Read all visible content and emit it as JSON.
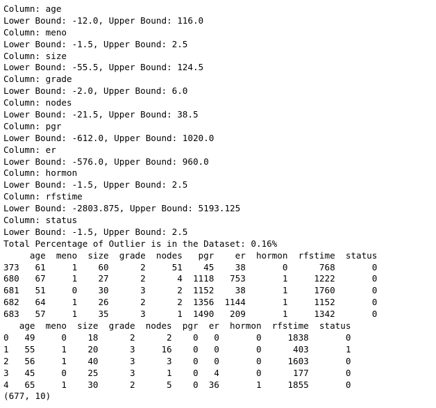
{
  "output": {
    "bounds": [
      {
        "column": "Column: age",
        "bounds": "Lower Bound: -12.0, Upper Bound: 116.0"
      },
      {
        "column": "Column: meno",
        "bounds": "Lower Bound: -1.5, Upper Bound: 2.5"
      },
      {
        "column": "Column: size",
        "bounds": "Lower Bound: -55.5, Upper Bound: 124.5"
      },
      {
        "column": "Column: grade",
        "bounds": "Lower Bound: -2.0, Upper Bound: 6.0"
      },
      {
        "column": "Column: nodes",
        "bounds": "Lower Bound: -21.5, Upper Bound: 38.5"
      },
      {
        "column": "Column: pgr",
        "bounds": "Lower Bound: -612.0, Upper Bound: 1020.0"
      },
      {
        "column": "Column: er",
        "bounds": "Lower Bound: -576.0, Upper Bound: 960.0"
      },
      {
        "column": "Column: hormon",
        "bounds": "Lower Bound: -1.5, Upper Bound: 2.5"
      },
      {
        "column": "Column: rfstime",
        "bounds": "Lower Bound: -2803.875, Upper Bound: 5193.125"
      },
      {
        "column": "Column: status",
        "bounds": "Lower Bound: -1.5, Upper Bound: 2.5"
      }
    ],
    "outlier_summary": "Total Percentage of Outlier is in the Dataset: 0.16%",
    "outlier_table": {
      "header": "     age  meno  size  grade  nodes   pgr    er  hormon  rfstime  status",
      "rows": [
        "373   61     1    60      2     51    45    38       0      768       0",
        "680   67     1    27      2      4  1118   753       1     1222       0",
        "681   51     0    30      3      2  1152    38       1     1760       0",
        "682   64     1    26      2      2  1356  1144       1     1152       0",
        "683   57     1    35      3      1  1490   209       1     1342       0"
      ]
    },
    "head_table": {
      "header": "   age  meno  size  grade  nodes  pgr  er  hormon  rfstime  status",
      "rows": [
        "0   49     0    18      2      2    0   0       0     1838       0",
        "1   55     1    20      3     16    0   0       0      403       1",
        "2   56     1    40      3      3    0   0       0     1603       0",
        "3   45     0    25      3      1    0   4       0      177       0",
        "4   65     1    30      2      5    0  36       1     1855       0"
      ]
    },
    "shape": "(677, 10)"
  }
}
